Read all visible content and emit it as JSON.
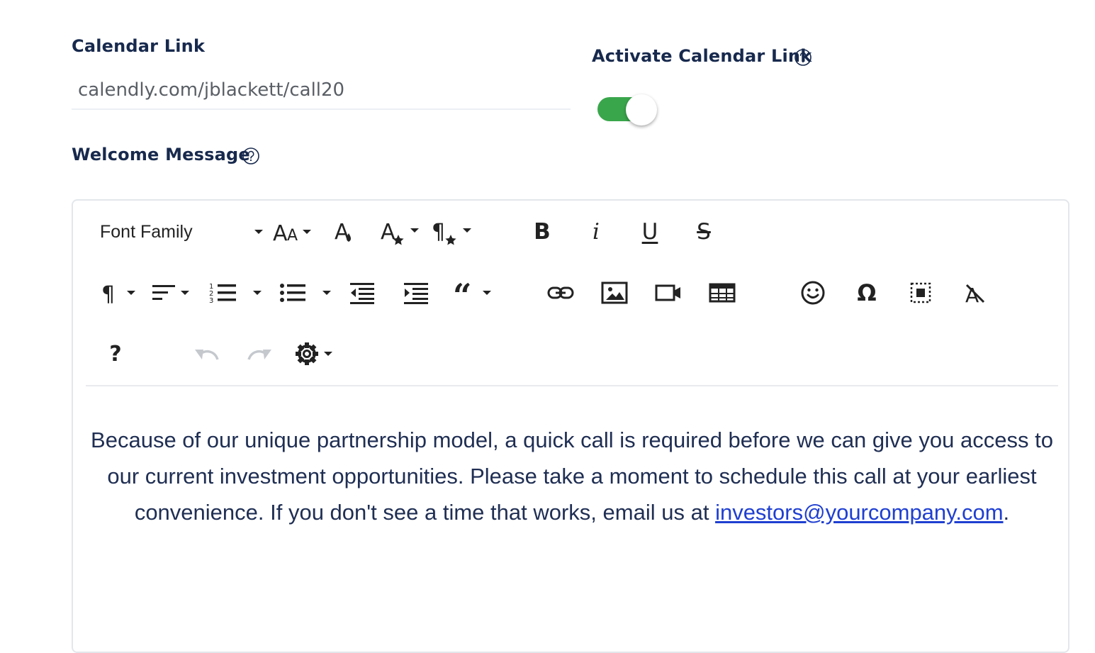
{
  "calendar": {
    "label": "Calendar Link",
    "value": "calendly.com/jblackett/call20"
  },
  "activate": {
    "label": "Activate Calendar Link",
    "enabled": true,
    "accent_color": "#3aa64c"
  },
  "welcome": {
    "label": "Welcome Message"
  },
  "toolbar": {
    "font_family_label": "Font Family",
    "help_label": "?",
    "row1": [
      "font-family-select",
      "font-size",
      "text-color",
      "inline-style",
      "paragraph-style",
      "bold",
      "italic",
      "underline",
      "strikethrough"
    ],
    "row2": [
      "paragraph-format",
      "align",
      "ordered-list",
      "unordered-list",
      "outdent",
      "indent",
      "quote",
      "insert-link",
      "insert-image",
      "insert-video",
      "insert-table",
      "emoticons",
      "special-characters",
      "select-all",
      "clear-formatting"
    ],
    "row3": [
      "help",
      "undo",
      "redo",
      "settings"
    ]
  },
  "message": {
    "text": "Because of our unique partnership model, a quick call is required before we can give you access to our current investment opportunities. Please take a moment to schedule this call at your earliest convenience. If you don't see a time that works, email us at",
    "email": "investors@yourcompany.com",
    "end": "."
  }
}
